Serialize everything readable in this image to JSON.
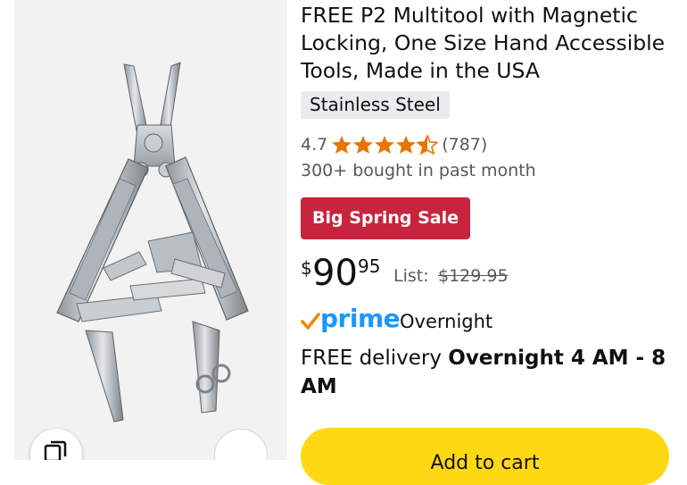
{
  "product": {
    "title": "FREE P2 Multitool with Magnetic Locking, One Size Hand Accessible Tools, Made in the USA",
    "variant": "Stainless Steel",
    "rating": "4.7",
    "stars": 4.7,
    "review_count": "(787)",
    "bought": "300+ bought in past month",
    "deal_badge": "Big Spring Sale",
    "price": {
      "currency": "$",
      "whole": "90",
      "fraction": "95"
    },
    "list_label": "List:",
    "list_price": "$129.95"
  },
  "delivery": {
    "prime": "prime",
    "prime_speed": "Overnight",
    "prefix": "FREE delivery ",
    "window": "Overnight 4 AM - 8 AM"
  },
  "actions": {
    "add_to_cart": "Add to cart"
  },
  "icons": {
    "view_similar": "view-similar-icon",
    "share": "share-icon",
    "star": "star-icon",
    "prime_check": "prime-check-icon"
  },
  "colors": {
    "star": "#e77600",
    "deal_badge": "#c7253e",
    "prime_blue": "#1a98ff",
    "add_to_cart": "#ffd814"
  }
}
